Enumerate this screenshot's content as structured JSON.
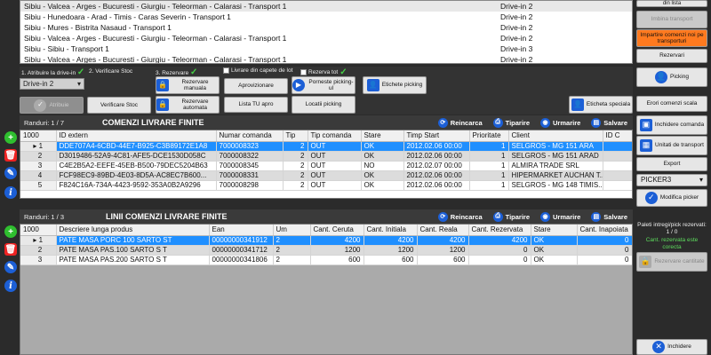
{
  "routes": [
    {
      "name": "Sibiu - Valcea - Arges - Bucuresti - Giurgiu - Teleorman - Calarasi - Transport 1",
      "drive": "Drive-in 2"
    },
    {
      "name": "Sibiu - Hunedoara - Arad - Timis - Caras Severin - Transport 1",
      "drive": "Drive-in 2"
    },
    {
      "name": "Sibiu - Mures - Bistrita Nasaud    - Transport 1",
      "drive": "Drive-in 2"
    },
    {
      "name": "Sibiu - Valcea - Arges - Bucuresti - Giurgiu - Teleorman - Calarasi - Transport 1",
      "drive": "Drive-in 2"
    },
    {
      "name": "Sibiu - Sibiu   - Transport 1",
      "drive": "Drive-in 3"
    },
    {
      "name": "Sibiu - Valcea - Arges - Bucuresti - Giurgiu - Teleorman - Calarasi - Transport 1",
      "drive": "Drive-in 2"
    }
  ],
  "right_panel": {
    "din_lista": "din lista",
    "imbina_transport": "Imbina transport",
    "impartire": "Impartire comenzi noi pe transporturi",
    "rezervari": "Rezervari",
    "picking": "Picking",
    "erori_comenzi": "Erori comenzi scala",
    "inchidere_comanda": "Inchidere comanda",
    "unitati_transport": "Unitati de transport",
    "export": "Export",
    "picker_select": "PICKER3",
    "modifica_picker": "Modifica picker",
    "paleti_title": "Paleti intregi/pick rezervati:",
    "paleti_value": "1 / 0",
    "cant_status": "Cant. rezervata este corecta",
    "rezervare_cantitate": "Rezervare cantitate",
    "inchidere": "Inchidere"
  },
  "steps": {
    "step1_label": "1. Atribuire la drive-in",
    "step1_value": "Drive-in 2",
    "step1_button": "Atribuie",
    "step2_label": "2. Verificare Stoc",
    "step2_button": "Verificare Stoc",
    "step3_label": "3. Rezervare",
    "rezervare_manuala": "Rezervare manuala",
    "rezervare_automata": "Rezervare automata",
    "livrare_din_capete": "Livrare din capete de lot",
    "rezerva_tot": "Rezerva tot",
    "aprovizionare": "Aprovizionare",
    "lista_tu_apro": "Lista TU apro",
    "porneste_picking": "Porneste picking-ul",
    "locatii_picking": "Locatii picking",
    "etichete_picking": "Etichete picking",
    "eticheta_speciala": "Eticheta speciala"
  },
  "orders": {
    "rows_label": "Randuri: 1 / 7",
    "title": "COMENZI LIVRARE FINITE",
    "reincarca": "Reincarca",
    "tiparire": "Tiparire",
    "urmarire": "Urmarire",
    "salvare": "Salvare",
    "columns": [
      "1000",
      "ID extern",
      "Numar comanda",
      "Tip",
      "Tip comanda",
      "Stare",
      "Timp Start",
      "Prioritate",
      "Client",
      "ID C"
    ],
    "rows": [
      {
        "rh": "1",
        "id": "DDE707A4-6CBD-44E7-B925-C3B89172E1A8",
        "nr": "7000008323",
        "tip": "2",
        "tipc": "OUT",
        "stare": "OK",
        "timp": "2012.02.06 00:00",
        "prio": "1",
        "client": "SELGROS - MG 151 ARA",
        "idc": ""
      },
      {
        "rh": "2",
        "id": "D3019486-52A9-4C81-AFE5-DCE1530D058C",
        "nr": "7000008322",
        "tip": "2",
        "tipc": "OUT",
        "stare": "OK",
        "timp": "2012.02.06 00:00",
        "prio": "1",
        "client": "SELGROS - MG 151 ARAD",
        "idc": ""
      },
      {
        "rh": "3",
        "id": "C4E2B5A2-EEFE-45EB-B500-79DEC5204B63",
        "nr": "7000008345",
        "tip": "2",
        "tipc": "OUT",
        "stare": "NO",
        "timp": "2012.02.07 00:00",
        "prio": "1",
        "client": "ALMIRA TRADE SRL",
        "idc": ""
      },
      {
        "rh": "4",
        "id": "FCF98EC9-89BD-4E03-8D5A-AC8EC7B600...",
        "nr": "7000008331",
        "tip": "2",
        "tipc": "OUT",
        "stare": "OK",
        "timp": "2012.02.06 00:00",
        "prio": "1",
        "client": "HIPERMARKET AUCHAN T...",
        "idc": ""
      },
      {
        "rh": "5",
        "id": "F824C16A-734A-4423-9592-353A0B2A9296",
        "nr": "7000008298",
        "tip": "2",
        "tipc": "OUT",
        "stare": "OK",
        "timp": "2012.02.06 00:00",
        "prio": "1",
        "client": "SELGROS - MG 148 TIMIS...",
        "idc": ""
      }
    ]
  },
  "lines": {
    "rows_label": "Randuri: 1 / 3",
    "title": "LINII COMENZI LIVRARE FINITE",
    "reincarca": "Reincarca",
    "tiparire": "Tiparire",
    "urmarire": "Urmarire",
    "salvare": "Salvare",
    "columns": [
      "1000",
      "Descriere lunga produs",
      "Ean",
      "Um",
      "Cant. Ceruta",
      "Cant. Initiala",
      "Cant. Reala",
      "Cant. Rezervata",
      "Stare",
      "Cant. Inapoiata",
      "Cant. Lips"
    ],
    "rows": [
      {
        "rh": "1",
        "desc": "PATE MASA PORC 100 SARTO ST",
        "ean": "00000000341912",
        "um": "2",
        "ceruta": "4200",
        "initiala": "4200",
        "reala": "4200",
        "rezervata": "4200",
        "stare": "OK",
        "inapoiata": "0",
        "lips": ""
      },
      {
        "rh": "2",
        "desc": "PATE MASA PAS.100 SARTO S T",
        "ean": "00000000341712",
        "um": "2",
        "ceruta": "1200",
        "initiala": "1200",
        "reala": "1200",
        "rezervata": "0",
        "stare": "OK",
        "inapoiata": "0",
        "lips": ""
      },
      {
        "rh": "3",
        "desc": "PATE MASA PAS.200 SARTO S T",
        "ean": "00000000341806",
        "um": "2",
        "ceruta": "600",
        "initiala": "600",
        "reala": "600",
        "rezervata": "0",
        "stare": "OK",
        "inapoiata": "0",
        "lips": ""
      }
    ]
  },
  "colors": {
    "selection": "#1f8fff",
    "accent": "#1c5fd6",
    "orange": "#ff7a1f",
    "ok_green": "#45d045"
  }
}
